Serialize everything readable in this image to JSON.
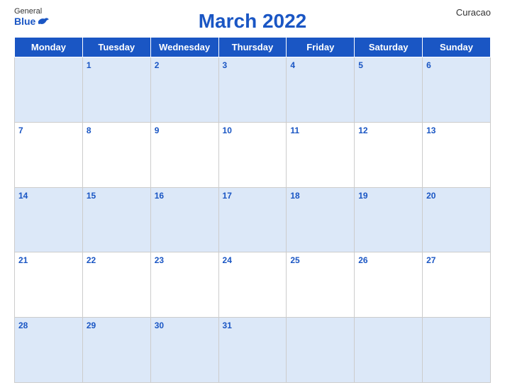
{
  "header": {
    "title": "March 2022",
    "country": "Curacao",
    "logo_general": "General",
    "logo_blue": "Blue"
  },
  "weekdays": [
    "Monday",
    "Tuesday",
    "Wednesday",
    "Thursday",
    "Friday",
    "Saturday",
    "Sunday"
  ],
  "weeks": [
    [
      null,
      "1",
      "2",
      "3",
      "4",
      "5",
      "6"
    ],
    [
      "7",
      "8",
      "9",
      "10",
      "11",
      "12",
      "13"
    ],
    [
      "14",
      "15",
      "16",
      "17",
      "18",
      "19",
      "20"
    ],
    [
      "21",
      "22",
      "23",
      "24",
      "25",
      "26",
      "27"
    ],
    [
      "28",
      "29",
      "30",
      "31",
      null,
      null,
      null
    ]
  ]
}
